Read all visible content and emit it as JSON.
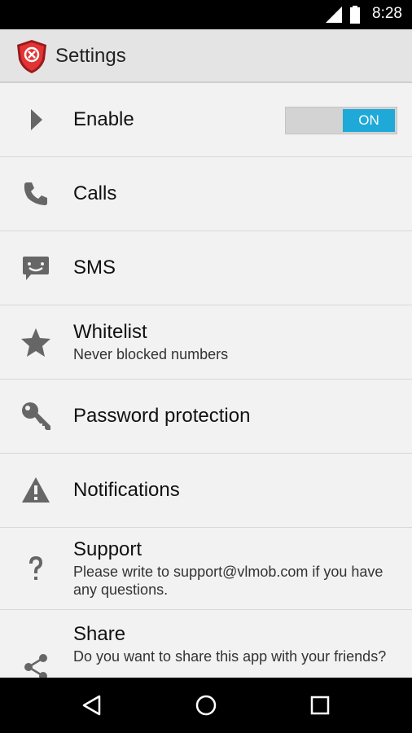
{
  "status_bar": {
    "time": "8:28"
  },
  "action_bar": {
    "title": "Settings"
  },
  "settings": {
    "enable": {
      "label": "Enable",
      "toggle_state": "ON"
    },
    "calls": {
      "label": "Calls"
    },
    "sms": {
      "label": "SMS"
    },
    "whitelist": {
      "label": "Whitelist",
      "subtitle": "Never blocked numbers"
    },
    "password": {
      "label": "Password protection"
    },
    "notifications": {
      "label": "Notifications"
    },
    "support": {
      "label": "Support",
      "subtitle": "Please write to support@vlmob.com if you have any questions."
    },
    "share": {
      "label": "Share",
      "subtitle": "Do you want to share this app with your friends?"
    }
  },
  "colors": {
    "accent": "#1ea9d8",
    "icon_gray": "#666666",
    "shield_red": "#d62a2a"
  },
  "icons": [
    "signal-icon",
    "battery-icon",
    "app-shield-icon",
    "play-arrow-icon",
    "phone-icon",
    "sms-icon",
    "star-icon",
    "key-icon",
    "warning-icon",
    "help-icon",
    "share-icon",
    "back-icon",
    "home-icon",
    "recents-icon"
  ]
}
